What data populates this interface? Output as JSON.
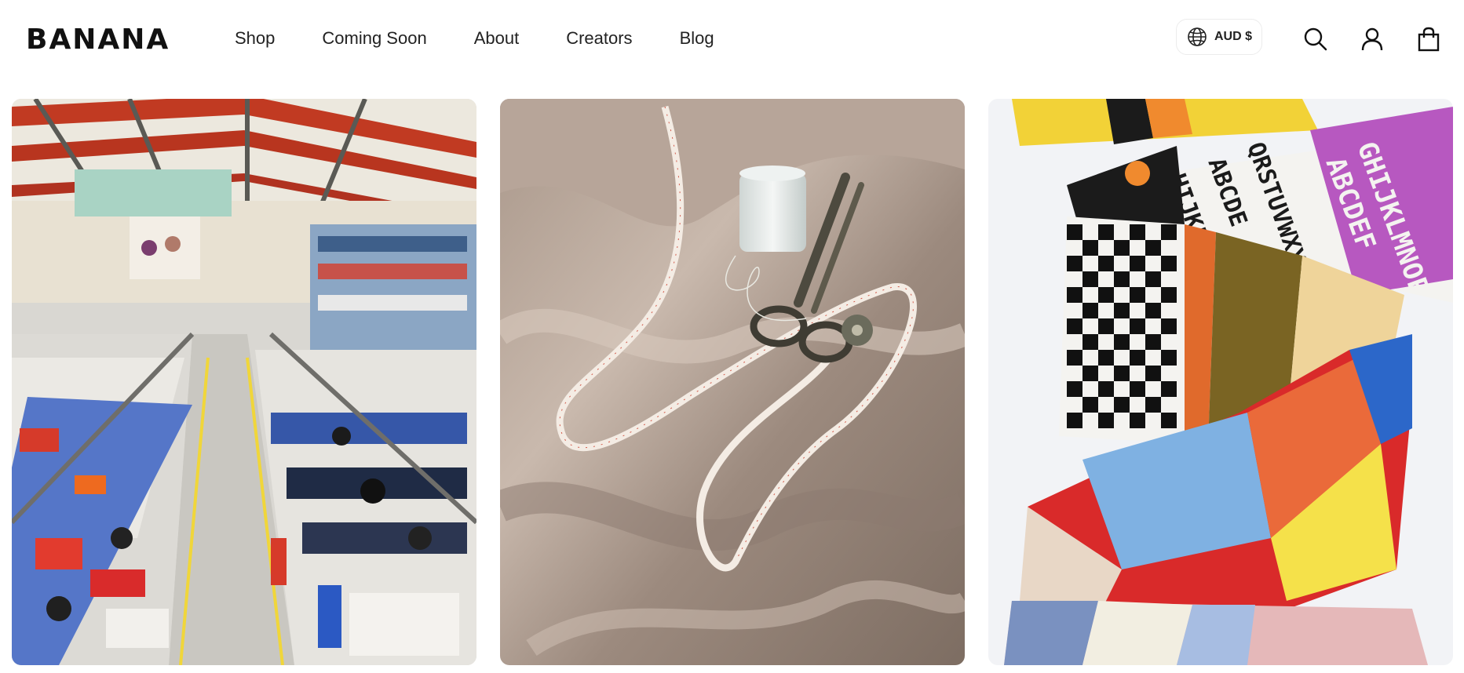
{
  "header": {
    "logo_text": "BANANA",
    "nav": [
      {
        "label": "Shop"
      },
      {
        "label": "Coming Soon"
      },
      {
        "label": "About"
      },
      {
        "label": "Creators"
      },
      {
        "label": "Blog"
      }
    ],
    "currency": {
      "label": "AUD $",
      "icon": "globe-icon"
    },
    "icons": {
      "search": "search-icon",
      "account": "user-icon",
      "cart": "shopping-bag-icon"
    }
  },
  "gallery": {
    "cards": [
      {
        "subject": "garment factory floor with sewing stations"
      },
      {
        "subject": "beige satin fabric with tape measure, thread spool and scissors"
      },
      {
        "subject": "colourful knitted patchwork scarves with alphabet pattern"
      }
    ],
    "knit_letters": [
      "ABCDEF",
      "GHIJKLMNOP",
      "QRSTUVWXYZ",
      "ABCDE",
      "HIJKL"
    ]
  },
  "colors": {
    "text": "#111111",
    "background": "#ffffff",
    "border": "#ececec"
  }
}
